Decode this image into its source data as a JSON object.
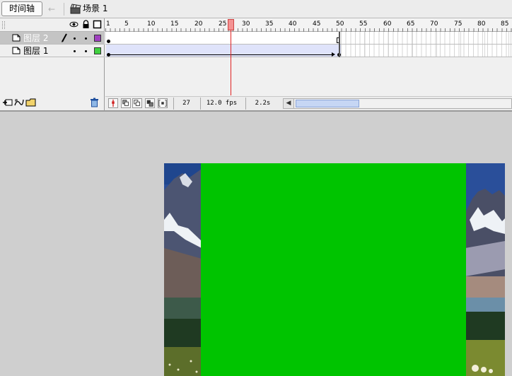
{
  "toolbar": {
    "timeline_tab": "时间轴",
    "scene_label": "场景 1"
  },
  "layers": [
    {
      "name": "图层 2",
      "color": "#a040c0",
      "selected": true
    },
    {
      "name": "图层 1",
      "color": "#40d040",
      "selected": false
    }
  ],
  "ruler": {
    "labels": [
      "1",
      "5",
      "10",
      "15",
      "20",
      "25",
      "30",
      "35",
      "40",
      "45",
      "50",
      "55",
      "60",
      "65",
      "70",
      "75",
      "80",
      "85"
    ]
  },
  "playback": {
    "current_frame": "27",
    "frame_rate": "12.0 fps",
    "elapsed_time": "2.2s"
  },
  "stage": {
    "fill_color": "#00c400"
  }
}
